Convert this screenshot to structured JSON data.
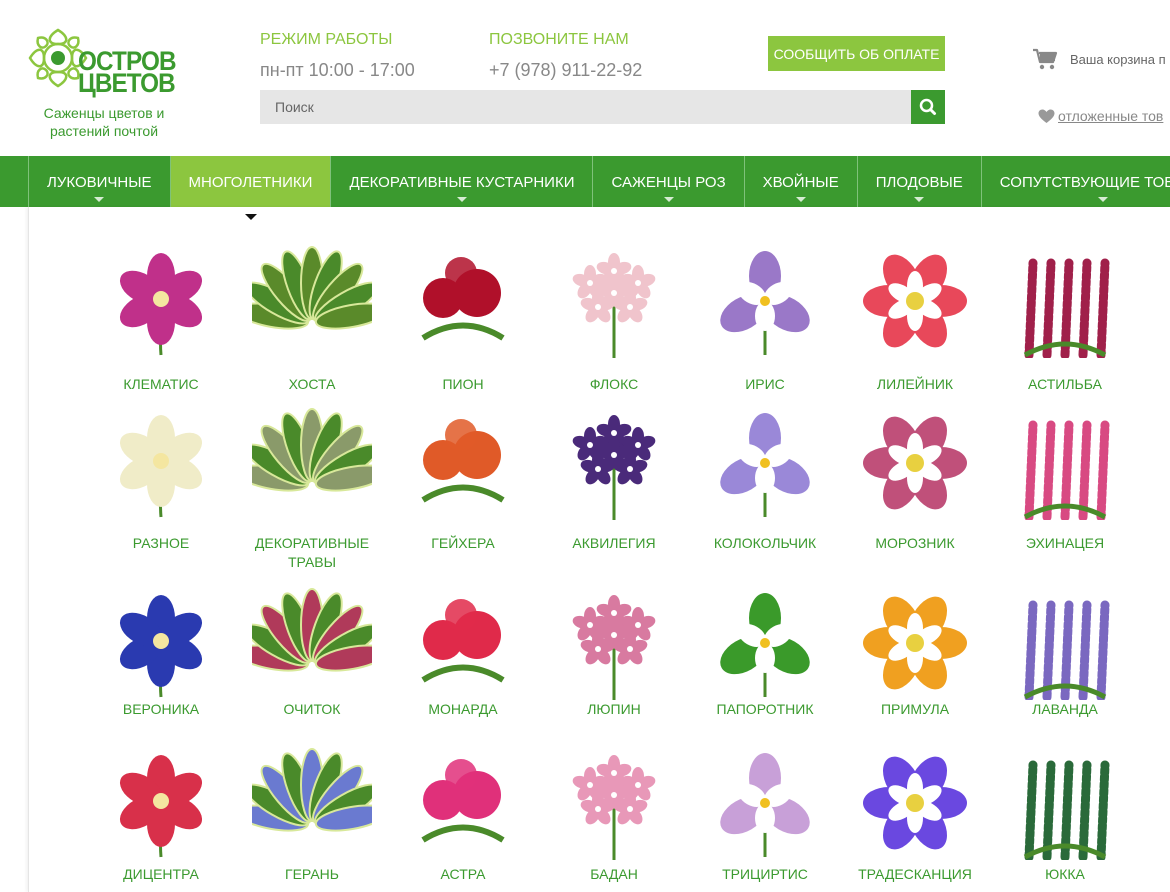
{
  "header": {
    "logo_line1": "ОСТРОВ",
    "logo_line2": "ЦВЕТОВ",
    "tagline": "Саженцы цветов и растений почтой",
    "work_label": "РЕЖИМ РАБОТЫ",
    "work_hours": "пн-пт 10:00 - 17:00",
    "call_label": "ПОЗВОНИТЕ НАМ",
    "phone": "+7 (978) 911-22-92",
    "pay_button": "СООБЩИТЬ ОБ ОПЛАТЕ",
    "search_placeholder": "Поиск",
    "cart_text": "Ваша корзина п",
    "wishlist_text": "отложенные тов"
  },
  "nav": [
    {
      "label": "ЛУКОВИЧНЫЕ",
      "active": false
    },
    {
      "label": "МНОГОЛЕТНИКИ",
      "active": true
    },
    {
      "label": "ДЕКОРАТИВНЫЕ КУСТАРНИКИ",
      "active": false
    },
    {
      "label": "САЖЕНЦЫ РОЗ",
      "active": false
    },
    {
      "label": "ХВОЙНЫЕ",
      "active": false
    },
    {
      "label": "ПЛОДОВЫЕ",
      "active": false
    },
    {
      "label": "СОПУТСТВУЮЩИЕ ТОВАРЫ",
      "active": false
    }
  ],
  "categories": [
    {
      "label": "КЛЕМАТИС",
      "icon": "clematis-flower-icon",
      "color": "#c0308a"
    },
    {
      "label": "ХОСТА",
      "icon": "hosta-leaves-icon",
      "color": "#5a8a2a"
    },
    {
      "label": "ПИОН",
      "icon": "peony-flower-icon",
      "color": "#b0102a"
    },
    {
      "label": "ФЛОКС",
      "icon": "phlox-flower-icon",
      "color": "#f0c4cc"
    },
    {
      "label": "ИРИС",
      "icon": "iris-flower-icon",
      "color": "#9a78c8"
    },
    {
      "label": "ЛИЛЕЙНИК",
      "icon": "daylily-flower-icon",
      "color": "#e8485a"
    },
    {
      "label": "АСТИЛЬБА",
      "icon": "astilbe-flower-icon",
      "color": "#a0204a"
    },
    {
      "label": "РАЗНОЕ",
      "icon": "misc-flower-icon",
      "color": "#f0ecc8"
    },
    {
      "label": "ДЕКОРАТИВНЫЕ ТРАВЫ",
      "icon": "ornamental-grass-icon",
      "color": "#8a9a6a"
    },
    {
      "label": "ГЕЙХЕРА",
      "icon": "heuchera-leaves-icon",
      "color": "#e05a28"
    },
    {
      "label": "АКВИЛЕГИЯ",
      "icon": "aquilegia-flower-icon",
      "color": "#4a2a7a"
    },
    {
      "label": "КОЛОКОЛЬЧИК",
      "icon": "bellflower-icon",
      "color": "#9a88d8"
    },
    {
      "label": "МОРОЗНИК",
      "icon": "hellebore-flower-icon",
      "color": "#c0507a"
    },
    {
      "label": "ЭХИНАЦЕЯ",
      "icon": "echinacea-flower-icon",
      "color": "#d84a82"
    },
    {
      "label": "ВЕРОНИКА",
      "icon": "veronica-flower-icon",
      "color": "#2a3ab0"
    },
    {
      "label": "ОЧИТОК",
      "icon": "sedum-flower-icon",
      "color": "#b03a5a"
    },
    {
      "label": "МОНАРДА",
      "icon": "monarda-flower-icon",
      "color": "#e02a4a"
    },
    {
      "label": "ЛЮПИН",
      "icon": "lupine-flower-icon",
      "color": "#d87aa0"
    },
    {
      "label": "ПАПОРОТНИК",
      "icon": "fern-icon",
      "color": "#3a9a2a"
    },
    {
      "label": "ПРИМУЛА",
      "icon": "primula-flower-icon",
      "color": "#f0a020"
    },
    {
      "label": "ЛАВАНДА",
      "icon": "lavender-icon",
      "color": "#7a68c0"
    },
    {
      "label": "ДИЦЕНТРА",
      "icon": "dicentra-flower-icon",
      "color": "#d8304a"
    },
    {
      "label": "ГЕРАНЬ",
      "icon": "geranium-flower-icon",
      "color": "#6a7ad0"
    },
    {
      "label": "АСТРА",
      "icon": "aster-flower-icon",
      "color": "#e0307a"
    },
    {
      "label": "БАДАН",
      "icon": "bergenia-icon",
      "color": "#e898b8"
    },
    {
      "label": "ТРИЦИРТИС",
      "icon": "tricyrtis-flower-icon",
      "color": "#c8a0d8"
    },
    {
      "label": "ТРАДЕСКАНЦИЯ",
      "icon": "tradescantia-flower-icon",
      "color": "#6a48e0"
    },
    {
      "label": "ЮККА",
      "icon": "yucca-icon",
      "color": "#2a6a3a"
    }
  ],
  "colors": {
    "brand_green": "#3b9a2f",
    "accent_green": "#8cc63f",
    "muted_text": "#888888"
  }
}
